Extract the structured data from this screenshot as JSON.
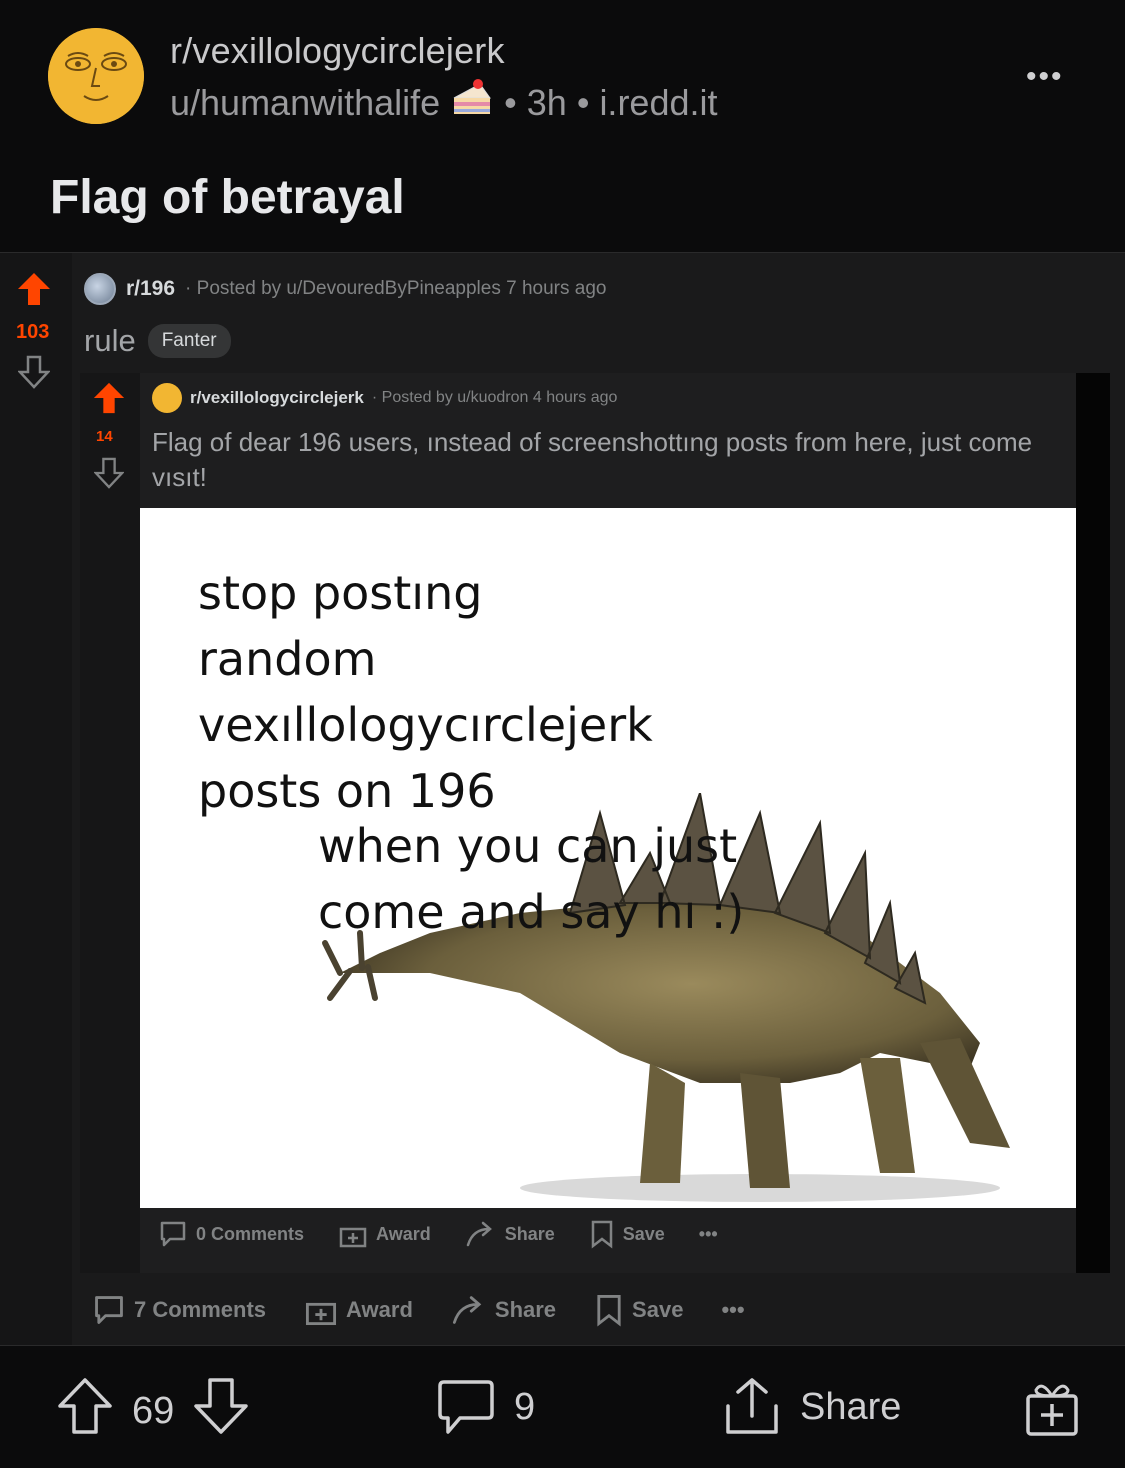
{
  "post": {
    "subreddit": "r/vexillologycirclejerk",
    "author": "u/humanwithalife",
    "author_flair_icon": "cake-icon",
    "age": "3h",
    "domain": "i.redd.it",
    "title": "Flag of betrayal"
  },
  "screenshot": {
    "outer": {
      "subreddit": "r/196",
      "meta": "· Posted by u/DevouredByPineapples 7 hours ago",
      "score": "103",
      "title": "rule",
      "flair": "Fanter",
      "actions": {
        "comments": "7 Comments",
        "award": "Award",
        "share": "Share",
        "save": "Save"
      }
    },
    "inner": {
      "subreddit": "r/vexillologycirclejerk",
      "meta": "· Posted by u/kuodron 4 hours ago",
      "score": "14",
      "title": "Flag of dear 196 users, ınstead of screenshottıng posts from here, just come vısıt!",
      "meme_lines": [
        "stop postıng",
        "random",
        "vexıllologycırclejerk",
        "posts on 196"
      ],
      "meme_lines2": [
        "when you can just",
        "come and say hı :)"
      ],
      "actions": {
        "comments": "0 Comments",
        "award": "Award",
        "share": "Share",
        "save": "Save"
      }
    }
  },
  "bottom_bar": {
    "votes": "69",
    "comments": "9",
    "share": "Share"
  },
  "colors": {
    "upvote": "#ff4500",
    "background": "#0b0b0c",
    "avatar": "#f2b632"
  }
}
